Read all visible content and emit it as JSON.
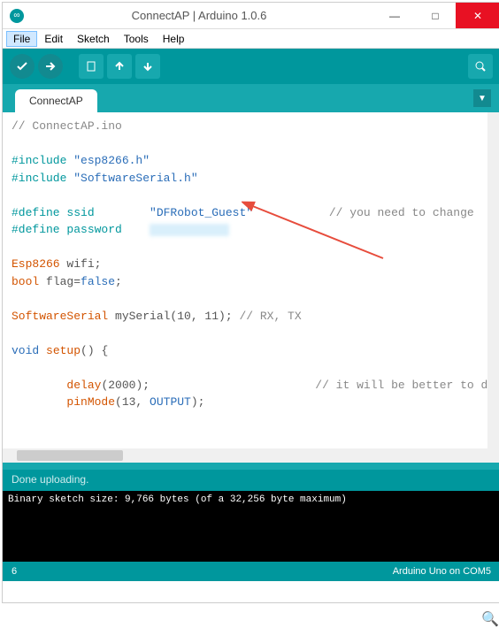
{
  "titlebar": {
    "title": "ConnectAP | Arduino 1.0.6"
  },
  "menubar": {
    "file": "File",
    "edit": "Edit",
    "sketch": "Sketch",
    "tools": "Tools",
    "help": "Help"
  },
  "tab": {
    "name": "ConnectAP"
  },
  "code": {
    "l1": "// ConnectAP.ino",
    "l2": "#include ",
    "l2s": "\"esp8266.h\"",
    "l3": "#include ",
    "l3s": "\"SoftwareSerial.h\"",
    "l4": "#define ssid        ",
    "l4s": "\"DFRobot_Guest\"",
    "l4c": "           // you need to change",
    "l5": "#define password    ",
    "l6a": "Esp8266",
    "l6b": " wifi;",
    "l7a": "bool",
    "l7b": " flag=",
    "l7c": "false",
    "l7d": ";",
    "l8a": "SoftwareSerial",
    "l8b": " mySerial(10, 11); ",
    "l8c": "// RX, TX",
    "l9a": "void",
    "l9b": " ",
    "l9c": "setup",
    "l9d": "() {",
    "l10a": "        ",
    "l10b": "delay",
    "l10c": "(2000);",
    "l10d": "                        // it will be better to delay",
    "l11a": "        ",
    "l11b": "pinMode",
    "l11c": "(13, ",
    "l11d": "OUTPUT",
    "l11e": ");"
  },
  "status": {
    "upload": "Done uploading."
  },
  "console": {
    "line1": "Binary sketch size: 9,766 bytes (of a 32,256 byte maximum)"
  },
  "statusbar": {
    "line": "6",
    "board": "Arduino Uno on COM5"
  }
}
